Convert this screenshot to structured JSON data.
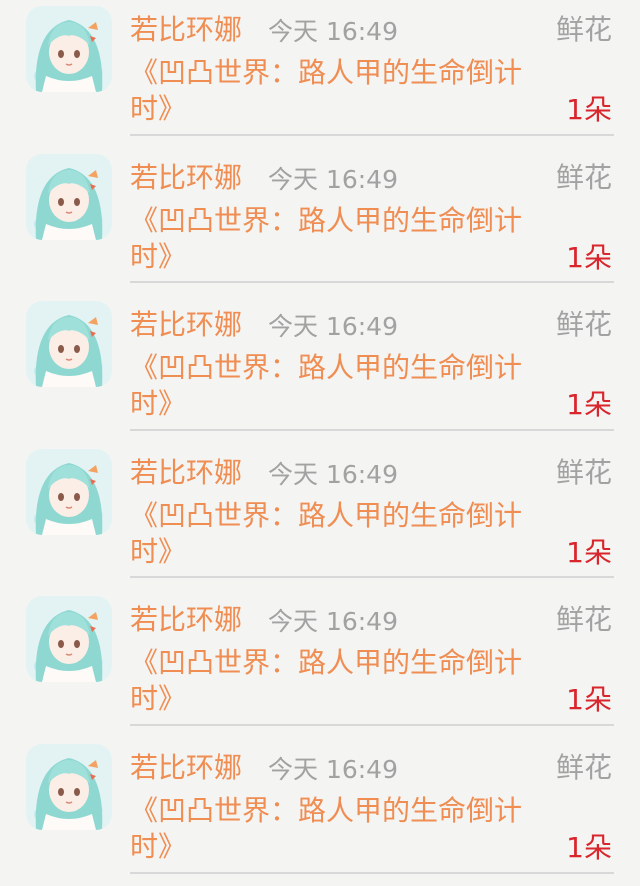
{
  "colors": {
    "accent": "#ef8d52",
    "muted": "#a2a2a2",
    "count_red": "#d9252c",
    "background": "#f4f4f2",
    "divider": "#d8d8d8"
  },
  "gift_list": {
    "items": [
      {
        "user": "若比环娜",
        "time": "今天 16:49",
        "gift_type": "鲜花",
        "book_title": "《凹凸世界：路人甲的生命倒计时》",
        "count": "1朵",
        "avatar_icon": "anime-girl-avatar"
      },
      {
        "user": "若比环娜",
        "time": "今天 16:49",
        "gift_type": "鲜花",
        "book_title": "《凹凸世界：路人甲的生命倒计时》",
        "count": "1朵",
        "avatar_icon": "anime-girl-avatar"
      },
      {
        "user": "若比环娜",
        "time": "今天 16:49",
        "gift_type": "鲜花",
        "book_title": "《凹凸世界：路人甲的生命倒计时》",
        "count": "1朵",
        "avatar_icon": "anime-girl-avatar"
      },
      {
        "user": "若比环娜",
        "time": "今天 16:49",
        "gift_type": "鲜花",
        "book_title": "《凹凸世界：路人甲的生命倒计时》",
        "count": "1朵",
        "avatar_icon": "anime-girl-avatar"
      },
      {
        "user": "若比环娜",
        "time": "今天 16:49",
        "gift_type": "鲜花",
        "book_title": "《凹凸世界：路人甲的生命倒计时》",
        "count": "1朵",
        "avatar_icon": "anime-girl-avatar"
      },
      {
        "user": "若比环娜",
        "time": "今天 16:49",
        "gift_type": "鲜花",
        "book_title": "《凹凸世界：路人甲的生命倒计时》",
        "count": "1朵",
        "avatar_icon": "anime-girl-avatar"
      }
    ]
  }
}
